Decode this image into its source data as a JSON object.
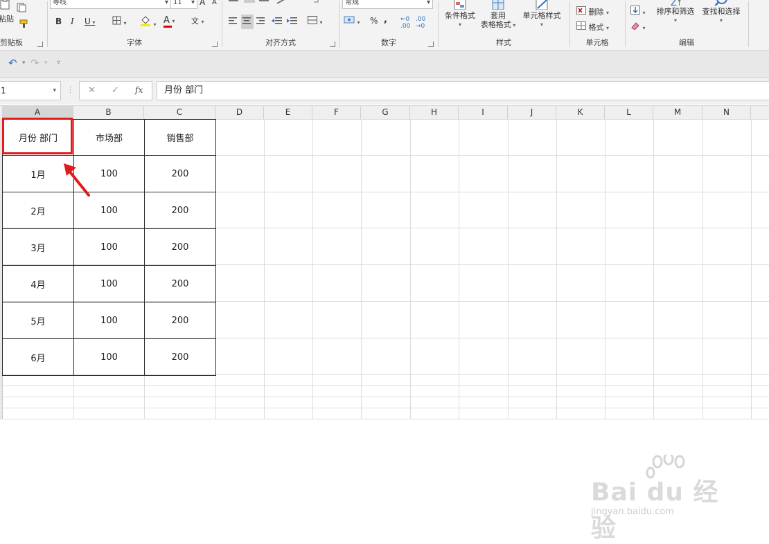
{
  "ribbon": {
    "clipboard": {
      "paste": "粘贴",
      "label": "剪贴板"
    },
    "font": {
      "label": "字体",
      "font_name": "等线",
      "font_size": "11",
      "grow": "A",
      "shrink": "A",
      "bold": "B",
      "italic": "I",
      "underline": "U",
      "fill_letter": "A"
    },
    "alignment": {
      "label": "对齐方式"
    },
    "number": {
      "label": "数字",
      "format": "常规",
      "percent": "%",
      "comma": ","
    },
    "styles": {
      "label": "样式",
      "conditional": "条件格式",
      "table_line1": "套用",
      "table_line2": "表格格式",
      "cell_styles": "单元格样式"
    },
    "cells": {
      "label": "单元格",
      "delete": "删除",
      "format": "格式"
    },
    "editing": {
      "label": "编辑",
      "sort": "排序和筛选",
      "find": "查找和选择"
    }
  },
  "formula_bar": {
    "name_box": "1",
    "cancel": "✕",
    "enter": "✓",
    "fx": "fx",
    "content": "月份 部门"
  },
  "columns": [
    "A",
    "B",
    "C",
    "D",
    "E",
    "F",
    "G",
    "H",
    "I",
    "J",
    "K",
    "L",
    "M",
    "N"
  ],
  "table": {
    "header": [
      "月份 部门",
      "市场部",
      "销售部"
    ],
    "rows": [
      [
        "1月",
        "100",
        "200"
      ],
      [
        "2月",
        "100",
        "200"
      ],
      [
        "3月",
        "100",
        "200"
      ],
      [
        "4月",
        "100",
        "200"
      ],
      [
        "5月",
        "100",
        "200"
      ],
      [
        "6月",
        "100",
        "200"
      ]
    ]
  },
  "watermark": {
    "brand": "Bai du 经验",
    "url": "jingyan.baidu.com"
  },
  "colors": {
    "highlight": "#e21b1b",
    "accent_red": "#c00000"
  }
}
